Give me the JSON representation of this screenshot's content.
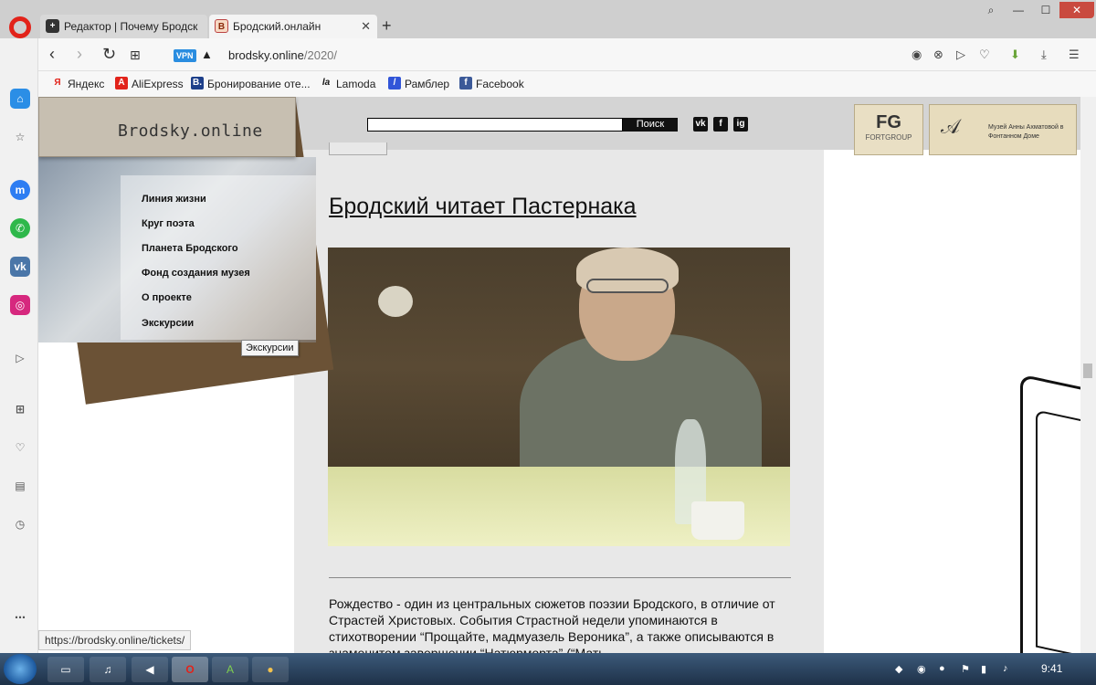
{
  "browser": {
    "tabs": [
      {
        "favicon": "+",
        "title": "Редактор | Почему Бродск"
      },
      {
        "favicon": "B",
        "title": "Бродский.онлайн"
      }
    ],
    "vpn": "VPN",
    "url_host": "brodsky.online",
    "url_path": "/2020/",
    "bookmarks": [
      {
        "icon": "Я",
        "label": "Яндекс",
        "color": "#e2231a"
      },
      {
        "icon": "A",
        "label": "AliExpress",
        "color": "#e2231a"
      },
      {
        "icon": "B.",
        "label": "Бронирование оте...",
        "color": "#1d3f8a"
      },
      {
        "icon": "la",
        "label": "Lamoda",
        "color": "#111111"
      },
      {
        "icon": "/",
        "label": "Рамблер",
        "color": "#3155d8"
      },
      {
        "icon": "f",
        "label": "Facebook",
        "color": "#3b5998"
      }
    ],
    "status_url": "https://brodsky.online/tickets/"
  },
  "site": {
    "logo": "Brodsky.online",
    "search_button": "Поиск",
    "social": [
      "vk",
      "f",
      "ig"
    ],
    "sponsor_fg_mark": "FG",
    "sponsor_fg_text": "FORTGROUP",
    "sponsor_museum_text": "Музей Анны Ахматовой в Фонтанном Доме",
    "menu": [
      "Линия жизни",
      "Круг поэта",
      "Планета Бродского",
      "Фонд создания музея",
      "О проекте",
      "Экскурсии"
    ],
    "tooltip": "Экскурсии"
  },
  "article": {
    "title": "Бродский читает Пастернака",
    "body": "Рождество - один из центральных сюжетов поэзии Бродского, в отличие от Страстей Христовых. События Страстной недели упоминаются в стихотворении “Прощайте, мадмуазель Вероника”, а также описываются в знаменитом завершении “Натюрморта” (“Мать"
  },
  "taskbar": {
    "clock": "9:41"
  }
}
